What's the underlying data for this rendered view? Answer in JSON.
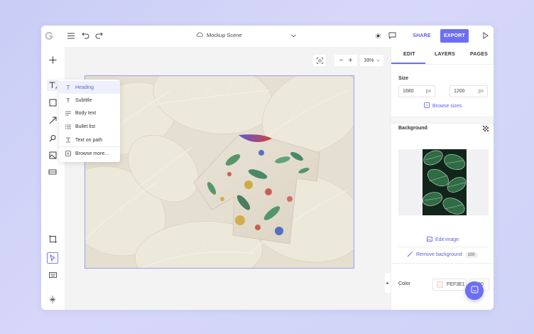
{
  "header": {
    "scene_title": "Mockup Scene",
    "share_label": "SHARE",
    "export_label": "EXPORT"
  },
  "canvas": {
    "zoom_value": "39%",
    "artboard_color": "#e4dfd0"
  },
  "text_menu": {
    "items": [
      {
        "label": "Heading",
        "icon": "text-t-icon",
        "selected": true
      },
      {
        "label": "Subtitle",
        "icon": "subtitle-icon",
        "selected": false
      },
      {
        "label": "Body text",
        "icon": "body-text-icon",
        "selected": false
      },
      {
        "label": "Bullet list",
        "icon": "bullet-list-icon",
        "selected": false
      },
      {
        "label": "Text on path",
        "icon": "text-path-icon",
        "selected": false
      },
      {
        "label": "Browse more...",
        "icon": "browse-icon",
        "selected": false
      }
    ]
  },
  "panel": {
    "tabs": [
      "EDIT",
      "LAYERS",
      "PAGES"
    ],
    "active_tab": "EDIT",
    "size": {
      "label": "Size",
      "width": "1680",
      "height": "1200",
      "unit": "px",
      "browse_label": "Browse sizes"
    },
    "background": {
      "label": "Background",
      "edit_image_label": "Edit image",
      "remove_bg_label": "Remove background",
      "remove_bg_badge": "100"
    },
    "color": {
      "label": "Color",
      "hex": "FEF3E1",
      "opacity": "100",
      "swatch": "#FEF3E1"
    }
  },
  "colors": {
    "accent": "#6c6ff2",
    "app_bg": "#cfd3f7"
  }
}
